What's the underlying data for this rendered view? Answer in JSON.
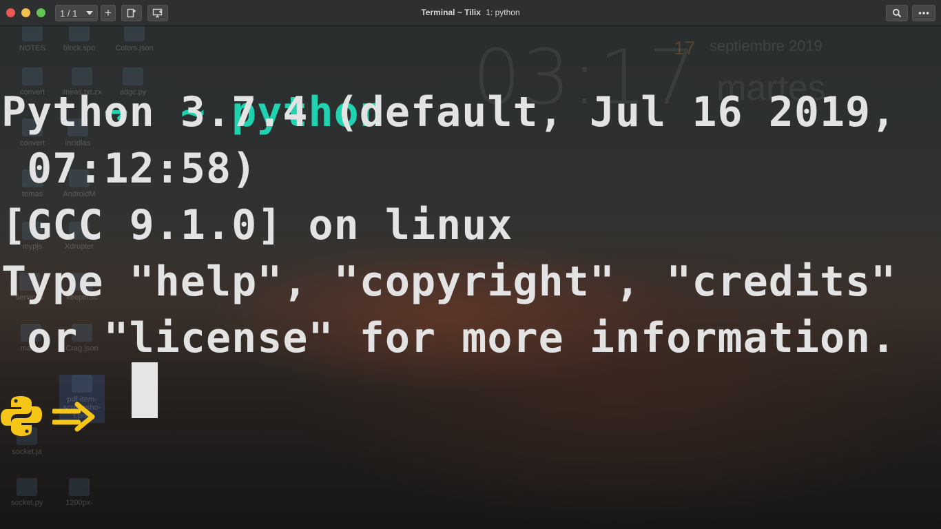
{
  "window": {
    "title": "Terminal ~ Tilix",
    "pane_label": "1: python",
    "session_indicator": "1 / 1",
    "add_label": "+"
  },
  "desktop": {
    "clock": "03:17",
    "date_number": "17",
    "date_text": "septiembre 2019",
    "day": "martes",
    "icons": [
      {
        "label": "NOTES"
      },
      {
        "label": "block.spo"
      },
      {
        "label": "Colors.json"
      },
      {
        "label": "convert"
      },
      {
        "label": "lineas.txt.zx"
      },
      {
        "label": "adgc.py"
      },
      {
        "label": "convert"
      },
      {
        "label": "incidias"
      },
      {
        "label": "temas"
      },
      {
        "label": "AndroidM"
      },
      {
        "label": "mypjs"
      },
      {
        "label": "Xdrupter"
      },
      {
        "label": "services"
      },
      {
        "label": "keepinSc"
      },
      {
        "label": "mateo"
      },
      {
        "label": "Crag.json"
      },
      {
        "label": "pdf-item-screensho-t.png"
      },
      {
        "label": "socket.ja"
      },
      {
        "label": "socket.py"
      },
      {
        "label": "1200px-"
      }
    ]
  },
  "terminal": {
    "prompt_arrow": "➜",
    "prompt_dir": "~",
    "command": "python",
    "lines": [
      "Python 3.7.4 (default, Jul 16 2019,",
      " 07:12:58)",
      "[GCC 9.1.0] on linux",
      "Type \"help\", \"copyright\", \"credits\"",
      " or \"license\" for more information."
    ],
    "repl_prompt_icon": "python-logo",
    "repl_prompt_arrow": "⇒"
  },
  "colors": {
    "prompt": "#1fd3b0",
    "text": "#e3e3e3",
    "python_yellow": "#f5c518",
    "titlebar": "#2d2f31"
  }
}
